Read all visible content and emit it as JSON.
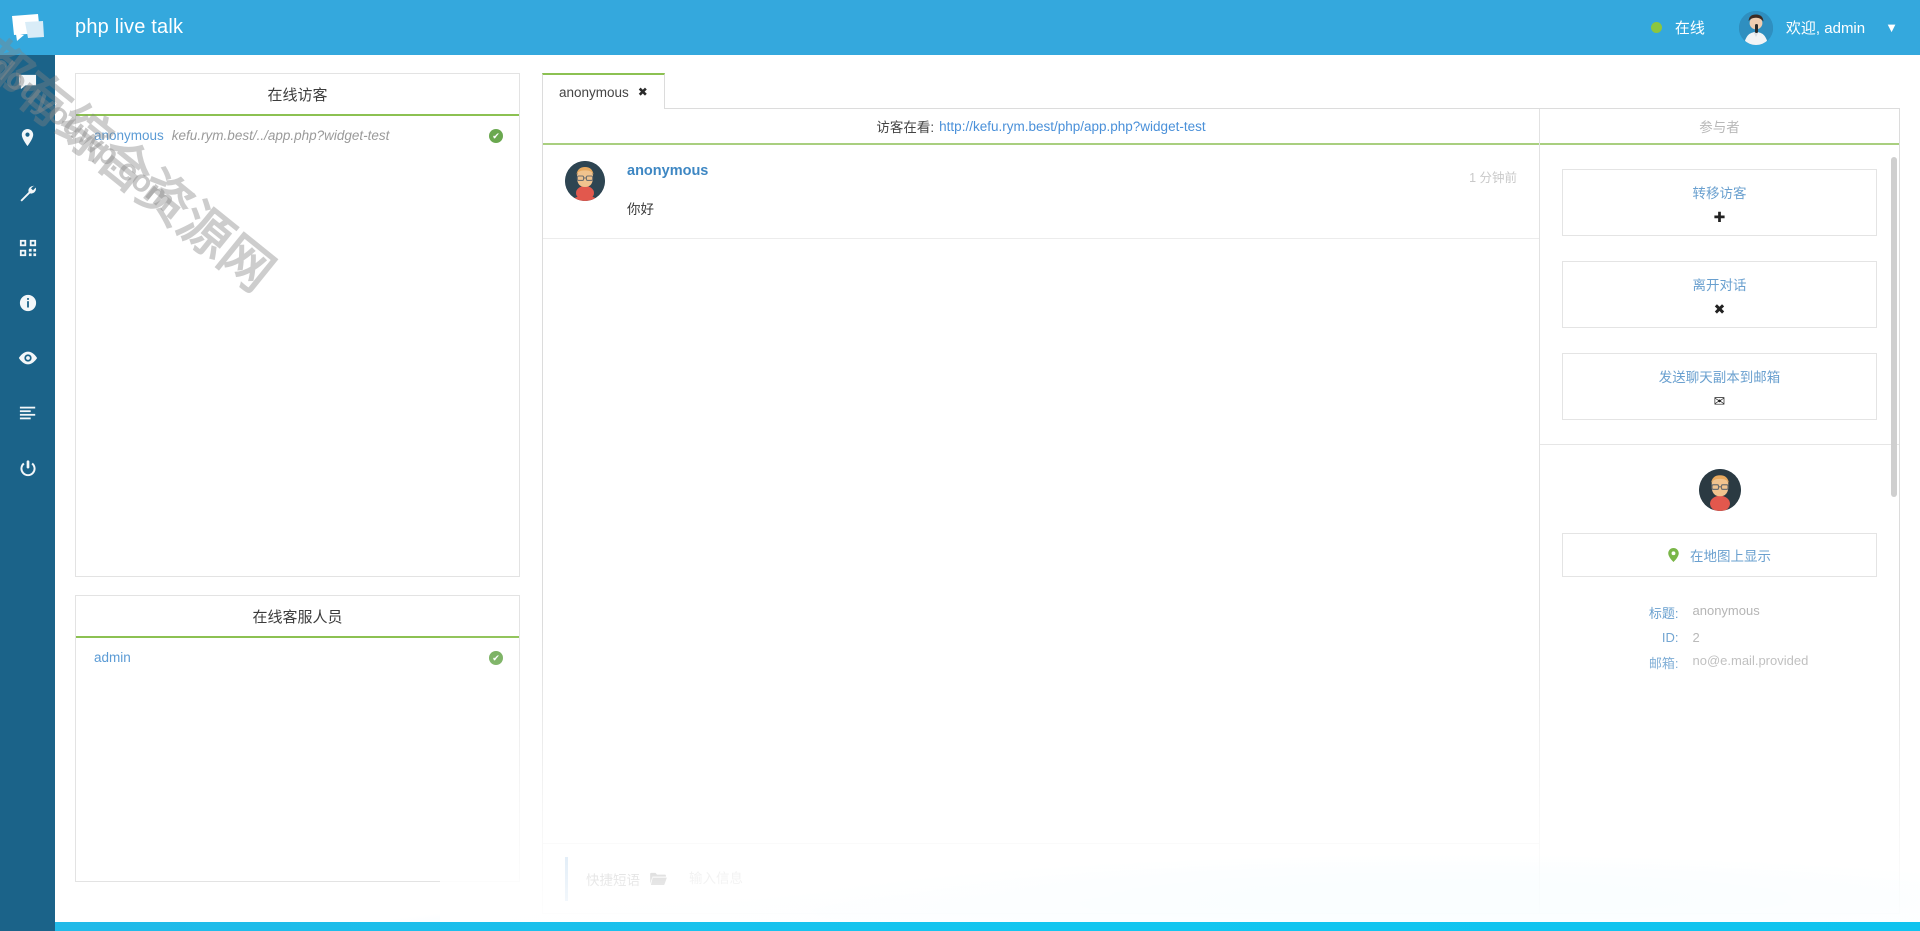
{
  "header": {
    "logo_icon": "live-chat-logo-icon",
    "title": "php live talk",
    "status_label": "在线",
    "status_color": "#8cc63e",
    "welcome_text": "欢迎, admin",
    "caret_glyph": "▼"
  },
  "rail": {
    "items": [
      {
        "name": "sidebar-item-chat",
        "icon": "chat-bubble-icon"
      },
      {
        "name": "sidebar-item-location",
        "icon": "map-pin-icon"
      },
      {
        "name": "sidebar-item-settings",
        "icon": "wrench-icon"
      },
      {
        "name": "sidebar-item-qrcode",
        "icon": "qr-code-icon"
      },
      {
        "name": "sidebar-item-info",
        "icon": "info-circle-icon"
      },
      {
        "name": "sidebar-item-monitor",
        "icon": "eye-icon"
      },
      {
        "name": "sidebar-item-logs",
        "icon": "list-lines-icon"
      },
      {
        "name": "sidebar-item-logout",
        "icon": "power-icon"
      }
    ]
  },
  "visitors_panel": {
    "title": "在线访客",
    "rows": [
      {
        "nick": "anonymous",
        "url": "kefu.rym.best/../app.php?widget-test",
        "online_glyph": "✔"
      }
    ]
  },
  "operators_panel": {
    "title": "在线客服人员",
    "rows": [
      {
        "name": "admin",
        "online_glyph": "✔"
      }
    ]
  },
  "chat": {
    "tab": {
      "label": "anonymous",
      "close_glyph": "✖"
    },
    "viewing": {
      "label": "访客在看:",
      "url": "http://kefu.rym.best/php/app.php?widget-test"
    },
    "messages": [
      {
        "author": "anonymous",
        "text": "你好",
        "time": "1 分钟前",
        "avatar": "visitor-avatar-icon"
      }
    ],
    "composer": {
      "quick_label": "快捷短语",
      "folder_icon": "folder-icon",
      "placeholder": "输入信息",
      "value": ""
    }
  },
  "side_panel": {
    "title": "参与者",
    "actions": [
      {
        "label": "转移访客",
        "glyph": "✚",
        "name": "transfer-visitor-button"
      },
      {
        "label": "离开对话",
        "glyph": "✖",
        "name": "leave-chat-button"
      },
      {
        "label": "发送聊天副本到邮箱",
        "glyph": "✉",
        "name": "email-transcript-button"
      }
    ],
    "profile": {
      "avatar": "visitor-avatar-icon",
      "map_button_label": "在地图上显示",
      "map_pin_icon": "map-pin-icon",
      "fields": [
        {
          "key": "标题:",
          "value": "anonymous"
        },
        {
          "key": "ID:",
          "value": "2"
        },
        {
          "key": "邮箱:",
          "value": "no@e.mail.provided"
        }
      ]
    }
  },
  "watermark": {
    "cn": "都有综合资源网",
    "en": "douyouwp.com"
  },
  "colors": {
    "brand_blue": "#34a8dd",
    "rail_blue": "#1b6389",
    "accent_green": "#8cc152",
    "link_blue": "#4a90d9",
    "online_green": "#6aa84f"
  }
}
